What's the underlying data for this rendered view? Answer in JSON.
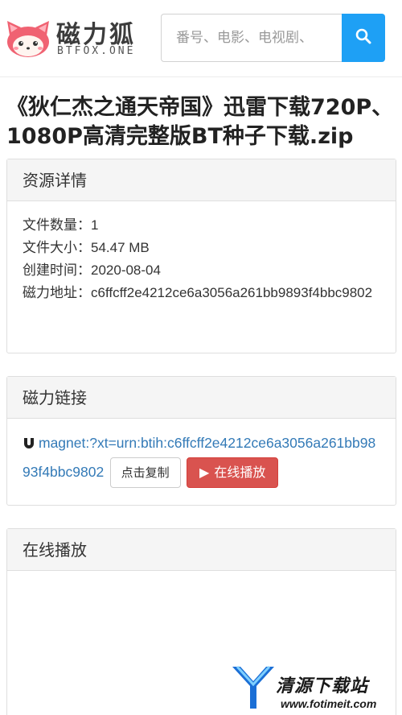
{
  "header": {
    "logo_title": "磁力狐",
    "logo_sub": "BTFOX.ONE",
    "search_placeholder": "番号、电影、电视剧、",
    "search_button_icon": "search-icon"
  },
  "title": "《狄仁杰之通天帝国》迅雷下载720P、1080P高清完整版BT种子下载.zip",
  "details_panel": {
    "heading": "资源详情",
    "rows": [
      {
        "key": "文件数量：",
        "value": "1"
      },
      {
        "key": "文件大小：",
        "value": "54.47 MB"
      },
      {
        "key": "创建时间：",
        "value": "2020-08-04"
      },
      {
        "key": "磁力地址：",
        "value": "c6ffcff2e4212ce6a3056a261bb9893f4bbc9802"
      }
    ]
  },
  "magnet_panel": {
    "heading": "磁力链接",
    "magnet_icon": "magnet-icon",
    "link_text": "magnet:?xt=urn:btih:c6ffcff2e4212ce6a3056a261bb9893f4bbc9802",
    "copy_label": "点击复制",
    "play_label": "在线播放"
  },
  "player_panel": {
    "heading": "在线播放"
  },
  "watermark": {
    "text": "清源下载站",
    "url": "www.fotimeit.com"
  },
  "colors": {
    "accent_blue": "#1ea0f5",
    "link_blue": "#337ab7",
    "danger_red": "#d9534f",
    "logo_pink": "#f06272"
  }
}
